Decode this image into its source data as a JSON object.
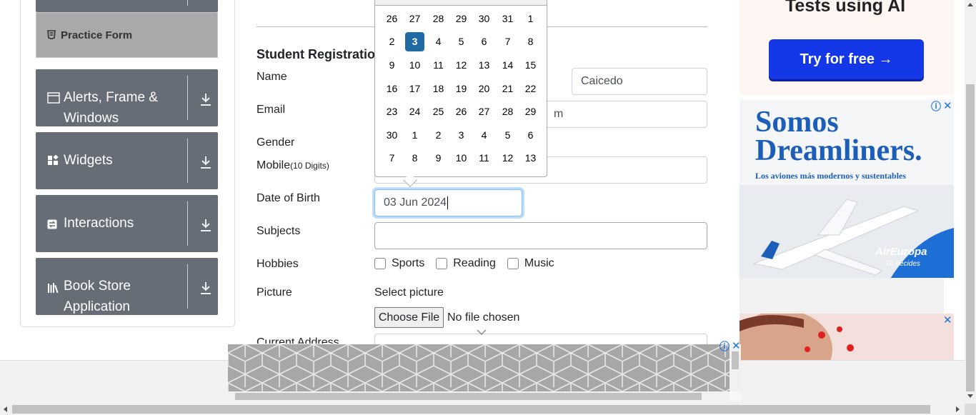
{
  "sidebar": {
    "practice_form": "Practice Form",
    "groups": [
      {
        "label": "Alerts, Frame & Windows"
      },
      {
        "label": "Widgets"
      },
      {
        "label": "Interactions"
      },
      {
        "label": "Book Store Application"
      }
    ]
  },
  "form": {
    "title": "Student Registratio",
    "labels": {
      "name": "Name",
      "email": "Email",
      "gender": "Gender",
      "mobile": "Mobile",
      "mobile_hint": "(10 Digits)",
      "dob": "Date of Birth",
      "subjects": "Subjects",
      "hobbies": "Hobbies",
      "picture": "Picture",
      "current_address": "Current Address"
    },
    "last_name_value": "Caicedo",
    "email_tail": "m",
    "dob_value": "03 Jun 2024",
    "hobbies": [
      "Sports",
      "Reading",
      "Music"
    ],
    "select_picture": "Select picture",
    "choose_file": "Choose File",
    "no_file": "No file chosen"
  },
  "datepicker": {
    "rows": [
      [
        "26",
        "27",
        "28",
        "29",
        "30",
        "31",
        "1"
      ],
      [
        "2",
        "3",
        "4",
        "5",
        "6",
        "7",
        "8"
      ],
      [
        "9",
        "10",
        "11",
        "12",
        "13",
        "14",
        "15"
      ],
      [
        "16",
        "17",
        "18",
        "19",
        "20",
        "21",
        "22"
      ],
      [
        "23",
        "24",
        "25",
        "26",
        "27",
        "28",
        "29"
      ],
      [
        "30",
        "1",
        "2",
        "3",
        "4",
        "5",
        "6"
      ],
      [
        "7",
        "8",
        "9",
        "10",
        "11",
        "12",
        "13"
      ]
    ],
    "selected": "3",
    "selected_color": "#216ba5"
  },
  "ads": {
    "top_heading": "Tests using AI",
    "try_button": "Try for free →",
    "mid_heading_1": "Somos",
    "mid_heading_2": "Dreamliners.",
    "mid_sub": "Los aviones más modernos y sustentables",
    "brand": "AirEuropa",
    "brand_tag": "Tú decides",
    "close_symbol": "✕",
    "info_symbol": "ⓘ"
  },
  "colors": {
    "sidebar_group": "#666d77",
    "practice_item": "#a9a9a9",
    "accent": "#216ba5"
  }
}
